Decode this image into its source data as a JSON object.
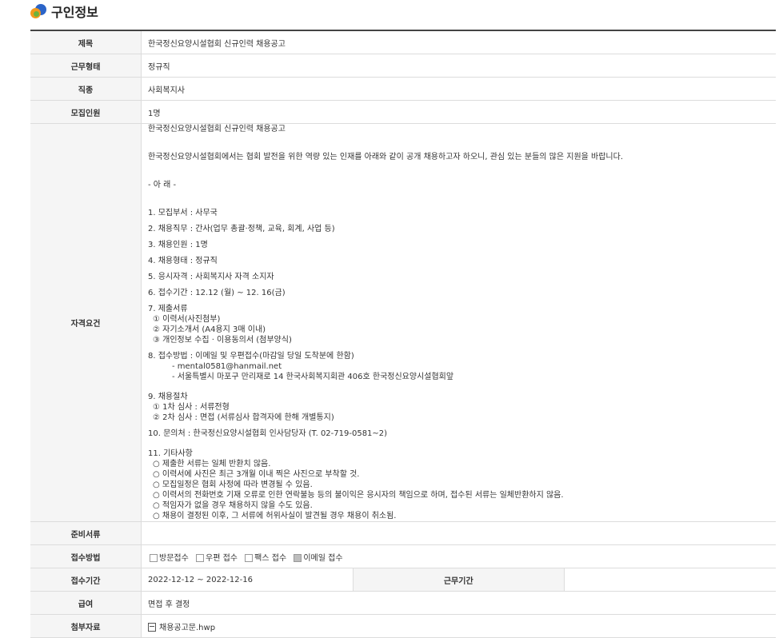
{
  "header": {
    "title": "구인정보"
  },
  "rows": {
    "title": {
      "label": "제목",
      "value": "한국정신요양시설협회 신규인력 채용공고"
    },
    "work_type": {
      "label": "근무형태",
      "value": "정규직"
    },
    "job": {
      "label": "직종",
      "value": "사회복지사"
    },
    "headcount": {
      "label": "모집인원",
      "value": "1명"
    },
    "requirements": {
      "label": "자격요건",
      "lines": {
        "l1": "한국정신요양시설협회 신규인력 채용공고",
        "l2": "한국정신요양시설협회에서는 협회 발전을 위한 역량 있는 인재를 아래와 같이 공개 채용하고자 하오니, 관심 있는 분들의 많은 지원을 바랍니다.",
        "l3": "- 아   래 -",
        "l4": "1. 모집부서 : 사무국",
        "l5": "2. 채용직무 : 간사(업무 총괄·정책, 교육, 회계, 사업 등)",
        "l6": "3. 채용인원 : 1명",
        "l7": "4. 채용형태 : 정규직",
        "l8": "5. 응시자격 : 사회복지사 자격 소지자",
        "l9": "6. 접수기간 : 12.12 (월) ~ 12. 16(금)",
        "l10": "7. 제출서류",
        "l11": "① 이력서(사진첨부)",
        "l12": "② 자기소개서 (A4용지 3매 이내)",
        "l13": "③ 개인정보 수집 · 이용동의서 (첨부양식)",
        "l14": "8. 접수방법 : 이메일 및 우편접수(마감일 당일 도착분에 한함)",
        "l15": "- mental0581@hanmail.net",
        "l16": "- 서울특별시 마포구 만리재로 14 한국사회복지회관 406호 한국정신요양시설협회앞",
        "l17": "9. 채용절차",
        "l18": "① 1차 심사 : 서류전형",
        "l19": "② 2차 심사 : 면접 (서류심사 합격자에 한해 개별통지)",
        "l20": "10. 문의처 : 한국정신요양시설협회 인사담당자 (T. 02-719-0581~2)",
        "l21": "11. 기타사항",
        "l22": "○ 제출한 서류는 일체 반환치 않음.",
        "l23": "○ 이력서에 사진은 최근 3개월 이내 찍은 사진으로 부착할 것.",
        "l24": "○ 모집일정은 협회 사정에 따라 변경될 수 있음.",
        "l25": "○ 이력서의 전화번호 기재 오류로 인한 연락불능 등의 불이익은 응시자의 책임으로 하며, 접수된 서류는 일체반환하지 않음.",
        "l26": "○ 적임자가 없을 경우 채용하지 않을 수도 있음.",
        "l27": "○ 채용이 결정된 이후, 그 서류에 허위사실이 발견될 경우 채용이 취소됨."
      }
    },
    "documents": {
      "label": "준비서류",
      "value": ""
    },
    "method": {
      "label": "접수방법",
      "options": {
        "visit": {
          "label": "방문접수",
          "checked": false
        },
        "mail": {
          "label": "우편 접수",
          "checked": false
        },
        "fax": {
          "label": "팩스 접수",
          "checked": false
        },
        "email": {
          "label": "이메일 접수",
          "checked": true
        }
      }
    },
    "period": {
      "label": "접수기간",
      "value": "2022-12-12 ~ 2022-12-16",
      "label2": "근무기간",
      "value2": ""
    },
    "salary": {
      "label": "급여",
      "value": "면접 후 결정"
    },
    "attachment": {
      "label": "첨부자료",
      "value": "채용공고문.hwp"
    }
  }
}
